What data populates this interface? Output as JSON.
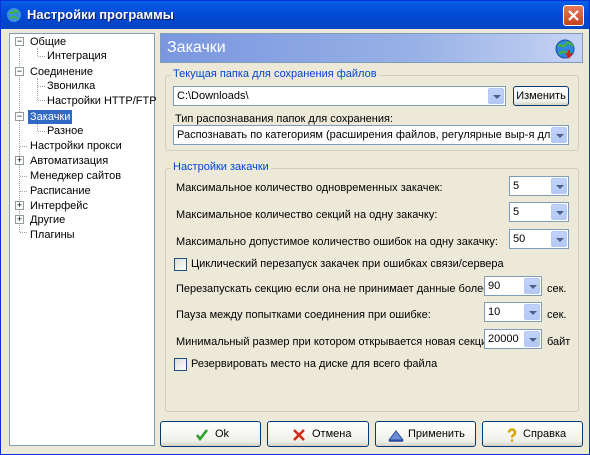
{
  "window": {
    "title": "Настройки программы"
  },
  "tree": {
    "items": [
      {
        "label": "Общие"
      },
      {
        "label": "Интеграция"
      },
      {
        "label": "Соединение"
      },
      {
        "label": "Звонилка"
      },
      {
        "label": "Настройки HTTP/FTP"
      },
      {
        "label": "Закачки"
      },
      {
        "label": "Разное"
      },
      {
        "label": "Настройки прокси"
      },
      {
        "label": "Автоматизация"
      },
      {
        "label": "Менеджер сайтов"
      },
      {
        "label": "Расписание"
      },
      {
        "label": "Интерфейс"
      },
      {
        "label": "Другие"
      },
      {
        "label": "Плагины"
      }
    ]
  },
  "header": {
    "title": "Закачки"
  },
  "folder_group": {
    "legend": "Текущая папка для сохранения файлов",
    "path_value": "C:\\Downloads\\",
    "change_button": "Изменить",
    "recognition_label": "Тип распознавания папок для сохранения:",
    "recognition_value": "Распознавать по категориям (расширения файлов, регулярные выр-я для URL"
  },
  "download_group": {
    "legend": "Настройки закачки",
    "max_downloads_label": "Максимальное количество одновременных закачек:",
    "max_downloads_value": "5",
    "max_sections_label": "Максимальное количество секций на одну закачку:",
    "max_sections_value": "5",
    "max_errors_label": "Максимально допустимое количество ошибок на одну закачку:",
    "max_errors_value": "50",
    "cyclic_restart_label": "Циклический перезапуск закачек при ошибках связи/сервера",
    "restart_section_label": "Перезапускать секцию если она не принимает данные более:",
    "restart_section_value": "90",
    "restart_section_unit": "сек.",
    "retry_pause_label": "Пауза между попытками соединения при ошибке:",
    "retry_pause_value": "10",
    "retry_pause_unit": "сек.",
    "min_section_label": "Минимальный размер при котором открывается новая секция:",
    "min_section_value": "20000",
    "min_section_unit": "байт",
    "reserve_space_label": "Резервировать место на диске для всего файла"
  },
  "buttons": {
    "ok": "Ok",
    "cancel": "Отмена",
    "apply": "Применить",
    "help": "Справка"
  }
}
